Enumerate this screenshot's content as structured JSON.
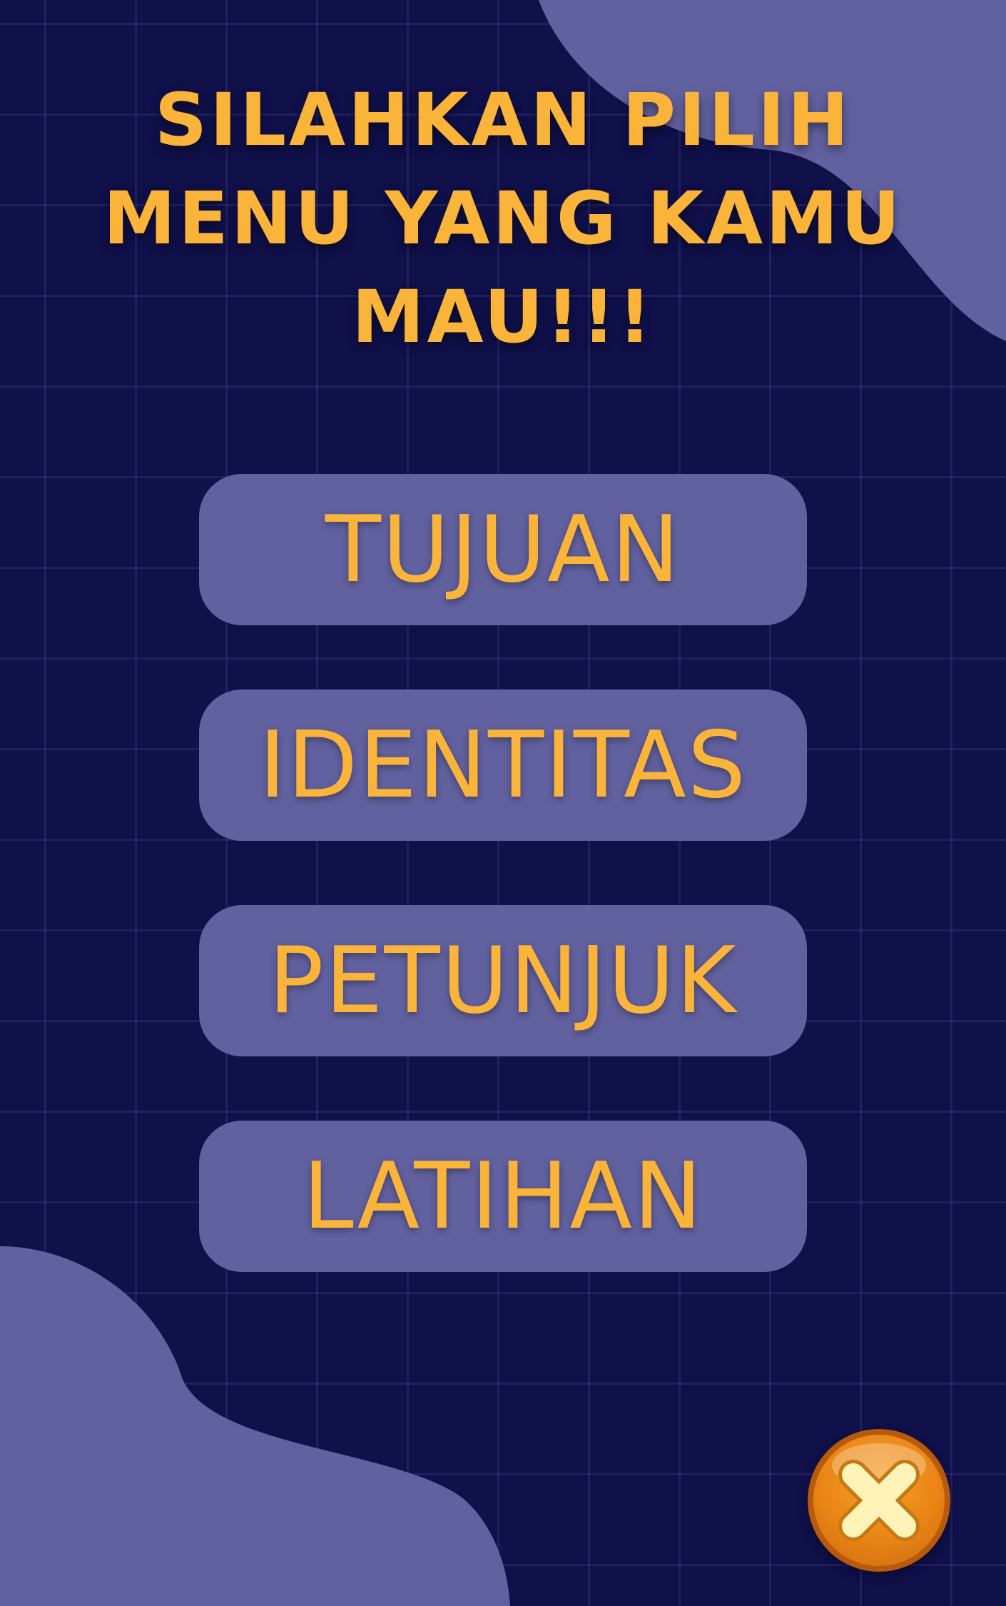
{
  "title": {
    "line1": "SILAHKAN PILIH",
    "line2": "MENU YANG KAMU",
    "line3": "MAU!!!"
  },
  "menu": {
    "items": [
      {
        "label": "TUJUAN"
      },
      {
        "label": "IDENTITAS"
      },
      {
        "label": "PETUNJUK"
      },
      {
        "label": "LATIHAN"
      }
    ]
  },
  "close": {
    "icon": "close-icon"
  },
  "colors": {
    "background": "#10104a",
    "accent": "#fbb43a",
    "button": "#6261a0",
    "close": "#ea8415"
  }
}
